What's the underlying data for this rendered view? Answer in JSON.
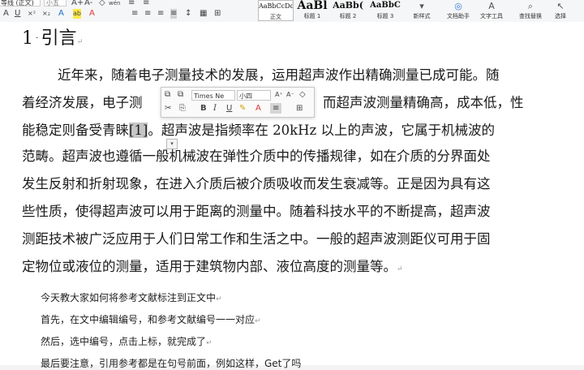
{
  "ribbon": {
    "font_name": "等线 (正文)",
    "font_size": "小五",
    "format_icons": [
      "A+",
      "A-",
      "◇",
      "wén",
      "A",
      "U",
      "×²",
      "×₂",
      "A",
      "ab",
      "A"
    ],
    "para_icons": [
      "≡",
      "≡",
      "≡",
      "≡",
      "≡",
      "≡",
      "↕",
      "▦",
      "⊞"
    ],
    "styles": [
      {
        "sample": "AaBbCcDd",
        "name": "正文"
      },
      {
        "sample": "AaBl",
        "name": "标题 1"
      },
      {
        "sample": "AaBb(",
        "name": "标题 2"
      },
      {
        "sample": "AaBbC",
        "name": "标题 3"
      }
    ],
    "tools": [
      {
        "glyph": "▾",
        "label": "新样式"
      },
      {
        "glyph": "◎",
        "label": "文档助手"
      },
      {
        "glyph": "A",
        "label": "文字工具"
      },
      {
        "glyph": "⌕",
        "label": "查找替换"
      },
      {
        "glyph": "↖",
        "label": "选择"
      }
    ]
  },
  "document": {
    "heading_num": "1",
    "heading_text": "引言",
    "lines": [
      "近年来，随着电子测量技术的发展，运用超声波作出精确测量已成可能。随",
      "着经济发展，电子测",
      "而超声波测量精确高，成本低，性",
      "能稳定则备受青睐",
      "[1]",
      "。超声波是指频率在 20kHz 以上的声波，它属于机械波的",
      "范畴。超声波也遵循一般机械波在弹性介质中的传播规律，如在介质的分界面处",
      "发生反射和折射现象，在进入介质后被介质吸收而发生衰减等。正是因为具有这",
      "些性质，使得超声波可以用于距离的测量中。随着科技水平的不断提高，超声波",
      "测距技术被广泛应用于人们日常工作和生活之中。一般的超声波测距仪可用于固",
      "定物位或液位的测量，适用于建筑物内部、液位高度的测量等。"
    ],
    "notes": [
      "今天教大家如何将参考文献标注到正文中",
      "首先，在文中编辑编号，和参考文献编号一一对应",
      "然后，选中编号，点击上标，就完成了",
      "最后要注意，引用参考都是在句号前面，例如这样，Get了吗"
    ]
  },
  "mini_toolbar": {
    "font": "Times Ne",
    "size": "小四",
    "row1": [
      "⧉",
      "⧉",
      "A⁺",
      "A⁻",
      "◇"
    ],
    "row2": [
      "✂",
      "⎘",
      "B",
      "I",
      "U",
      "✎",
      "A",
      "≡",
      "⊞"
    ]
  }
}
